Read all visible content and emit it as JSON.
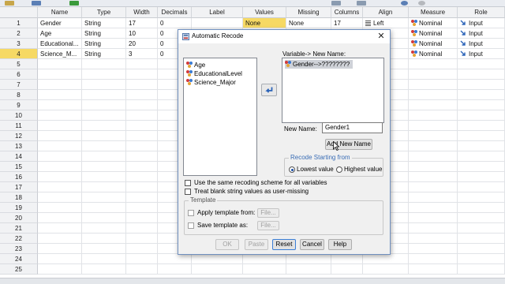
{
  "toolbar": {
    "icons": [
      "open-file-icon",
      "save-icon",
      "print-icon",
      "recall-dialog-icon",
      "undo-icon"
    ]
  },
  "grid": {
    "columns": [
      "Name",
      "Type",
      "Width",
      "Decimals",
      "Label",
      "Values",
      "Missing",
      "Columns",
      "Align",
      "Measure",
      "Role"
    ],
    "row_numbers": [
      "1",
      "2",
      "3",
      "4",
      "5",
      "6",
      "7",
      "8",
      "9",
      "10",
      "11",
      "12",
      "13",
      "14",
      "15",
      "16",
      "17",
      "18",
      "19",
      "20",
      "21",
      "22",
      "23",
      "24",
      "25"
    ],
    "rows": [
      {
        "name": "Gender",
        "type": "String",
        "width": "17",
        "decimals": "0",
        "label": "",
        "values": "None",
        "missing": "None",
        "columns": "17",
        "align": "Left",
        "measure": "Nominal",
        "role": "Input"
      },
      {
        "name": "Age",
        "type": "String",
        "width": "10",
        "decimals": "0",
        "label": "",
        "values": "",
        "missing": "",
        "columns": "",
        "align": "",
        "measure": "Nominal",
        "role": "Input"
      },
      {
        "name": "Educational...",
        "type": "String",
        "width": "20",
        "decimals": "0",
        "label": "",
        "values": "",
        "missing": "",
        "columns": "",
        "align": "",
        "measure": "Nominal",
        "role": "Input"
      },
      {
        "name": "Science_M...",
        "type": "String",
        "width": "3",
        "decimals": "0",
        "label": "",
        "values": "",
        "missing": "",
        "columns": "",
        "align": "",
        "measure": "Nominal",
        "role": "Input"
      }
    ],
    "active_row": "4"
  },
  "dialog": {
    "title": "Automatic Recode",
    "close_glyph": "✕",
    "source_variables": [
      "Age",
      "EducationalLevel",
      "Science_Major"
    ],
    "target_label": "Variable-> New Name:",
    "target_items": [
      "Gender-->????????"
    ],
    "move_glyph": "↩",
    "new_name_label": "New Name:",
    "new_name_value": "Gender1",
    "add_new_name_label": "Add New Name",
    "recode_group_title": "Recode Starting from",
    "lowest_value_label": "Lowest value",
    "highest_value_label": "Highest value",
    "recode_from": "Lowest value",
    "same_scheme_label": "Use the same recoding scheme for all variables",
    "blank_missing_label": "Treat blank string values as user-missing",
    "template_group_title": "Template",
    "apply_template_label": "Apply template from:",
    "save_template_label": "Save template as:",
    "file_button_label": "File...",
    "buttons": {
      "ok": "OK",
      "paste": "Paste",
      "reset": "Reset",
      "cancel": "Cancel",
      "help": "Help"
    }
  },
  "colors": {
    "selected_cell": "#f6d964",
    "dialog_border": "#6f8fbf",
    "group_title": "#3a6db5"
  }
}
